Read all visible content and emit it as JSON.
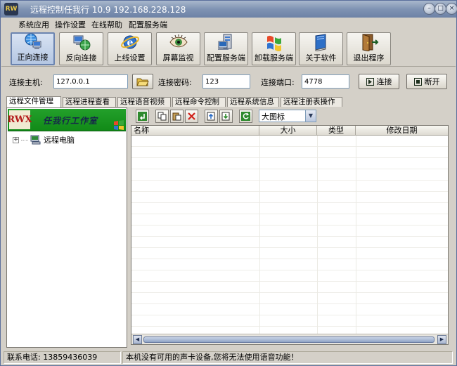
{
  "window": {
    "title": "远程控制任我行 10.9  192.168.228.128",
    "minimize_label": "–",
    "maximize_label": "□",
    "close_label": "×"
  },
  "menu": [
    "系统应用",
    "操作设置",
    "在线帮助",
    "配置服务端"
  ],
  "toolbar": [
    {
      "label": "正向连接",
      "icon": "globe-computer-icon",
      "active": true
    },
    {
      "label": "反向连接",
      "icon": "computer-globe-icon",
      "active": false
    },
    {
      "label": "上线设置",
      "icon": "internet-explorer-icon",
      "active": false
    },
    {
      "label": "屏幕监视",
      "icon": "eye-icon",
      "active": false
    },
    {
      "label": "配置服务端",
      "icon": "server-config-icon",
      "active": false
    },
    {
      "label": "卸载服务端",
      "icon": "windows-logo-icon",
      "active": false
    },
    {
      "label": "关于软件",
      "icon": "book-icon",
      "active": false
    },
    {
      "label": "退出程序",
      "icon": "exit-door-icon",
      "active": false
    }
  ],
  "connection": {
    "host_label": "连接主机:",
    "host_value": "127.0.0.1",
    "password_label": "连接密码:",
    "password_value": "123",
    "port_label": "连接端口:",
    "port_value": "4778",
    "connect_label": "连接",
    "disconnect_label": "断开"
  },
  "tabs": [
    "远程文件管理",
    "远程进程查看",
    "远程语音视频",
    "远程命令控制",
    "远程系统信息",
    "远程注册表操作"
  ],
  "banner": {
    "mark": "RWX",
    "text": "任我行工作室"
  },
  "tree": {
    "node_label": "远程电脑",
    "expander": "+"
  },
  "file_toolbar": {
    "view_selected": "大图标"
  },
  "file_list": {
    "columns": [
      "名称",
      "大小",
      "类型",
      "修改日期"
    ]
  },
  "status": {
    "phone": "联系电话: 13859436039",
    "message": "本机没有可用的声卡设备,您将无法使用语音功能！"
  },
  "colors": {
    "titlebar": "#7f93b3",
    "window_bg": "#d4d0c8",
    "banner_green": "#1a9622",
    "active_button": "#b4c6e2"
  }
}
